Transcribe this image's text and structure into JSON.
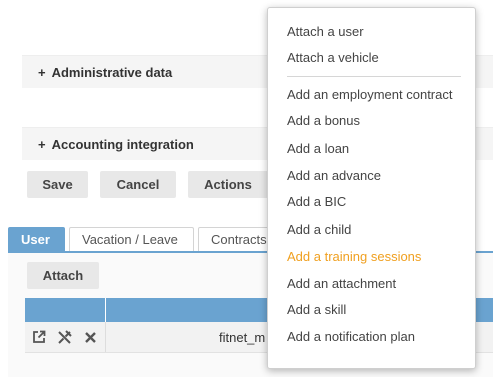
{
  "sections": {
    "administrative": {
      "plus": "+",
      "label": "Administrative data"
    },
    "accounting": {
      "plus": "+",
      "label": "Accounting integration"
    }
  },
  "buttons": {
    "save": "Save",
    "cancel": "Cancel",
    "actions": "Actions",
    "attach": "Attach"
  },
  "tabs": [
    {
      "label": "User",
      "active": true
    },
    {
      "label": "Vacation / Leave",
      "active": false
    },
    {
      "label": "Contracts",
      "active": false
    }
  ],
  "table": {
    "row": {
      "icons": [
        "external-link-icon",
        "unlink-icon",
        "close-icon"
      ],
      "value": "fitnet_m"
    }
  },
  "menu": {
    "group1": [
      "Attach a user",
      "Attach a vehicle"
    ],
    "group2": [
      "Add an employment contract",
      "Add a bonus",
      "Add a loan",
      "Add an advance",
      "Add a BIC",
      "Add a child",
      "Add a training sessions",
      "Add an attachment",
      "Add a skill",
      "Add a notification plan"
    ],
    "highlighted": "Add a training sessions"
  },
  "colors": {
    "accent": "#6aa3d0",
    "highlight": "#f0a020"
  }
}
